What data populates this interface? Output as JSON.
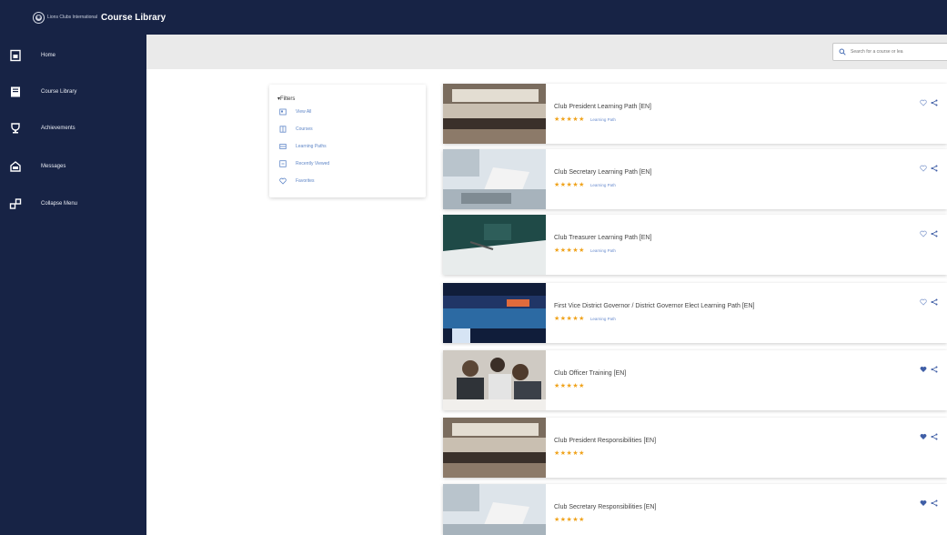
{
  "header": {
    "org_name": "Lions Clubs International",
    "title": "Course Library"
  },
  "sidebar": {
    "items": [
      {
        "label": "Home",
        "icon": "home-icon"
      },
      {
        "label": "Course Library",
        "icon": "book-icon"
      },
      {
        "label": "Achievements",
        "icon": "trophy-icon"
      },
      {
        "label": "Messages",
        "icon": "inbox-icon"
      },
      {
        "label": "Collapse Menu",
        "icon": "collapse-icon"
      }
    ]
  },
  "search": {
    "placeholder": "Search for a course or lea"
  },
  "filters": {
    "title": "▾Filters",
    "items": [
      {
        "label": "View All",
        "icon": "view-all-icon"
      },
      {
        "label": "Courses",
        "icon": "courses-icon"
      },
      {
        "label": "Learning Paths",
        "icon": "learning-paths-icon"
      },
      {
        "label": "Recently Viewed",
        "icon": "recent-icon"
      },
      {
        "label": "Favorites",
        "icon": "heart-icon"
      }
    ]
  },
  "courses": [
    {
      "title": "Club President Learning Path [EN]",
      "rating": "★★★★★",
      "type": "Learning Path",
      "favorited": false
    },
    {
      "title": "Club Secretary Learning Path [EN]",
      "rating": "★★★★★",
      "type": "Learning Path",
      "favorited": false
    },
    {
      "title": "Club Treasurer Learning Path [EN]",
      "rating": "★★★★★",
      "type": "Learning Path",
      "favorited": false
    },
    {
      "title": "First Vice District Governor / District Governor Elect Learning Path [EN]",
      "rating": "★★★★★",
      "type": "Learning Path",
      "favorited": false
    },
    {
      "title": "Club Officer Training [EN]",
      "rating": "★★★★★",
      "type": "",
      "favorited": true
    },
    {
      "title": "Club President Responsibilities [EN]",
      "rating": "★★★★★",
      "type": "",
      "favorited": true
    },
    {
      "title": "Club Secretary Responsibilities [EN]",
      "rating": "★★★★★",
      "type": "",
      "favorited": true
    }
  ],
  "colors": {
    "navy": "#172345",
    "accent_blue": "#5f86c7",
    "star": "#f0a31c"
  }
}
